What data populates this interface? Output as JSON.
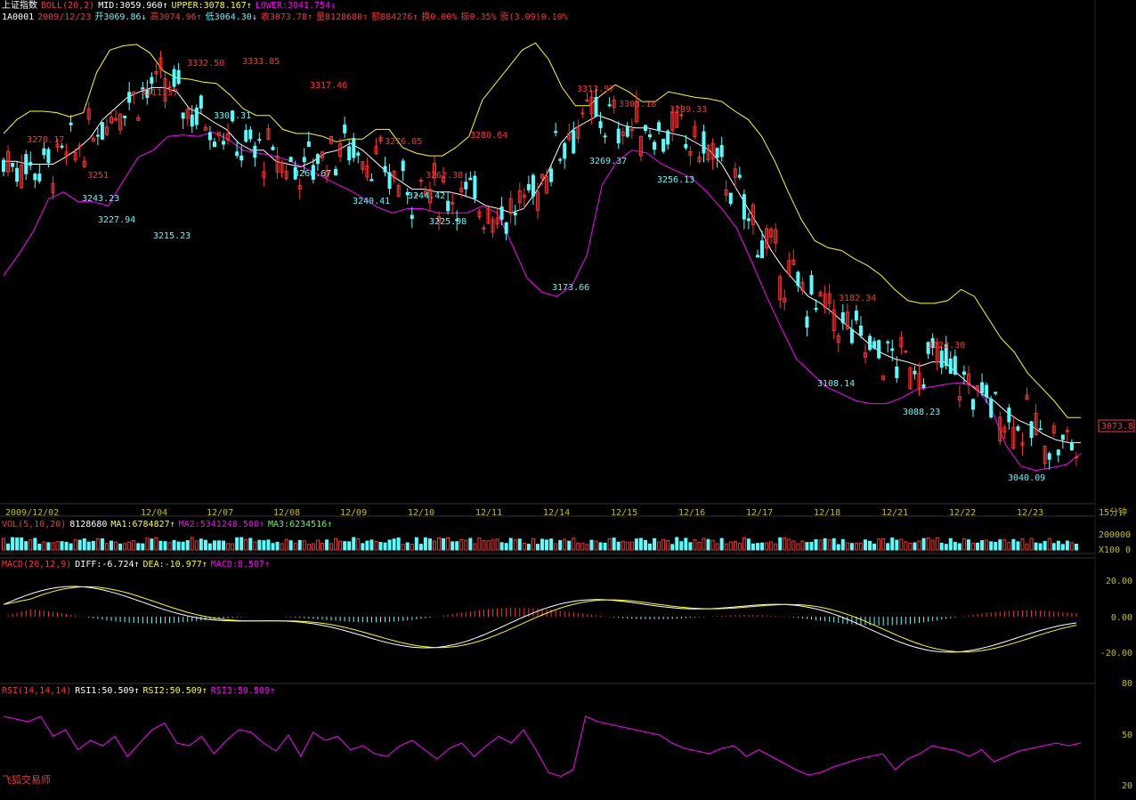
{
  "header": {
    "line1": {
      "name": "上证指数",
      "boll": "BOLL(20,2)",
      "mid": "MID:3059.960↑",
      "upper": "UPPER:3078.167↑",
      "lower": "LOWER:3041.754↓"
    },
    "line2": {
      "code": "1A0001",
      "date": "2009/12/23",
      "open": "开3069.86↓",
      "high": "高3074.96↑",
      "low": "低3064.30↓",
      "close": "收3073.78↑",
      "vol": "量8128680↑",
      "amt": "额884276↑",
      "turnover": "换0.00%",
      "amp": "振0.35%",
      "chg": "涨(3.09)0.10%"
    }
  },
  "colors": {
    "bg": "#000000",
    "up": "#ff3232",
    "down": "#54ffff",
    "mid": "#ffffff",
    "upper": "#ffff00",
    "lower": "#ff00ff",
    "axis": "#c0c000"
  },
  "price_panel": {
    "last_price_tag": "3073.8",
    "high_labels": [
      "3278.17",
      "3311.37",
      "3332.50",
      "3333.85",
      "3317.46",
      "3276.05",
      "3280.64",
      "3313.97",
      "3303.18",
      "3289.33",
      "3182.34",
      "3122.30",
      "3251",
      "3262.38"
    ],
    "low_labels": [
      "3243.23",
      "3227.94",
      "3215.23",
      "3302.31",
      "3260.67",
      "3240.41",
      "3244.42",
      "3225.98",
      "3173.66",
      "3269.37",
      "3256.13",
      "3108.14",
      "3088.23",
      "3040.09"
    ]
  },
  "date_axis": {
    "labels": [
      "2009/12/02",
      "12/04",
      "12/07",
      "12/08",
      "12/09",
      "12/10",
      "12/11",
      "12/14",
      "12/15",
      "12/16",
      "12/17",
      "12/18",
      "12/21",
      "12/22",
      "12/23"
    ],
    "period": "15分钟"
  },
  "vol_panel": {
    "title": "VOL(5,10,20)",
    "value": "8128680",
    "ma1": "MA1:6784827↑",
    "ma2": "MA2:5341248.500↑",
    "ma3": "MA3:6234516↑",
    "y_labels": [
      "200000",
      "X100",
      "0"
    ]
  },
  "macd_panel": {
    "title": "MACD(26,12,9)",
    "diff": "DIFF:-6.724↑",
    "dea": "DEA:-10.977↑",
    "macd": "MACD:8.507↑",
    "y_labels": [
      "20.00",
      "0.00",
      "-20.00"
    ]
  },
  "rsi_panel": {
    "title": "RSI(14,14,14)",
    "rsi1": "RSI1:50.509↑",
    "rsi2": "RSI2:50.509↑",
    "rsi3": "RSI3:50.509↑",
    "y_labels": [
      "80",
      "50",
      "20"
    ]
  },
  "brand": "飞狐交易师",
  "chart_data": {
    "type": "line",
    "boll_mid": [
      3262,
      3262,
      3260,
      3260,
      3260,
      3265,
      3271,
      3279,
      3292,
      3300,
      3308,
      3312,
      3315,
      3315,
      3312,
      3300,
      3296,
      3290,
      3285,
      3275,
      3270,
      3270,
      3262,
      3260,
      3258,
      3262,
      3268,
      3270,
      3275,
      3270,
      3262,
      3254,
      3248,
      3242,
      3242,
      3240,
      3240,
      3238,
      3235,
      3230,
      3228,
      3225,
      3228,
      3240,
      3255,
      3275,
      3285,
      3290,
      3295,
      3292,
      3288,
      3286,
      3286,
      3284,
      3282,
      3280,
      3275,
      3270,
      3260,
      3245,
      3230,
      3215,
      3198,
      3185,
      3175,
      3165,
      3160,
      3153,
      3145,
      3138,
      3130,
      3124,
      3120,
      3118,
      3115,
      3118,
      3118,
      3110,
      3102,
      3095,
      3090,
      3082,
      3076,
      3072,
      3066,
      3062,
      3060,
      3060
    ],
    "boll_upper": [
      3282,
      3292,
      3298,
      3298,
      3297,
      3294,
      3297,
      3326,
      3342,
      3345,
      3346,
      3340,
      3327,
      3322,
      3321,
      3319,
      3318,
      3310,
      3300,
      3295,
      3295,
      3285,
      3282,
      3282,
      3280,
      3276,
      3278,
      3278,
      3285,
      3285,
      3272,
      3268,
      3266,
      3266,
      3272,
      3280,
      3306,
      3318,
      3330,
      3342,
      3347,
      3335,
      3315,
      3302,
      3302,
      3310,
      3317,
      3312,
      3305,
      3305,
      3312,
      3310,
      3308,
      3307,
      3305,
      3298,
      3292,
      3280,
      3262,
      3240,
      3220,
      3205,
      3200,
      3198,
      3192,
      3187,
      3180,
      3170,
      3162,
      3160,
      3160,
      3162,
      3170,
      3165,
      3150,
      3135,
      3125,
      3110,
      3100,
      3090,
      3078,
      3078
    ],
    "boll_lower": [
      3180,
      3195,
      3212,
      3235,
      3240,
      3233,
      3233,
      3230,
      3248,
      3265,
      3270,
      3280,
      3281,
      3280,
      3283,
      3278,
      3270,
      3268,
      3266,
      3263,
      3258,
      3253,
      3247,
      3242,
      3236,
      3229,
      3225,
      3228,
      3228,
      3225,
      3225,
      3225,
      3230,
      3225,
      3202,
      3178,
      3168,
      3165,
      3173,
      3195,
      3245,
      3262,
      3270,
      3268,
      3260,
      3255,
      3250,
      3240,
      3228,
      3214,
      3190,
      3165,
      3142,
      3120,
      3110,
      3100,
      3095,
      3090,
      3088,
      3088,
      3092,
      3098,
      3100,
      3102,
      3103,
      3100,
      3085,
      3058,
      3043,
      3040,
      3042,
      3044,
      3052
    ],
    "rsi": [
      70,
      68,
      66,
      70,
      55,
      60,
      45,
      52,
      48,
      55,
      40,
      50,
      60,
      65,
      50,
      48,
      55,
      42,
      52,
      60,
      58,
      50,
      44,
      56,
      40,
      58,
      52,
      55,
      45,
      48,
      42,
      40,
      48,
      52,
      45,
      38,
      46,
      50,
      40,
      48,
      55,
      50,
      60,
      45,
      28,
      25,
      30,
      70,
      66,
      64,
      62,
      60,
      58,
      56,
      50,
      46,
      44,
      42,
      46,
      48,
      40,
      45,
      40,
      35,
      30,
      26,
      28,
      32,
      35,
      38,
      40,
      42,
      30,
      38,
      42,
      48,
      46,
      44,
      40,
      45,
      36,
      40,
      44,
      46,
      48,
      50,
      48,
      50
    ]
  }
}
